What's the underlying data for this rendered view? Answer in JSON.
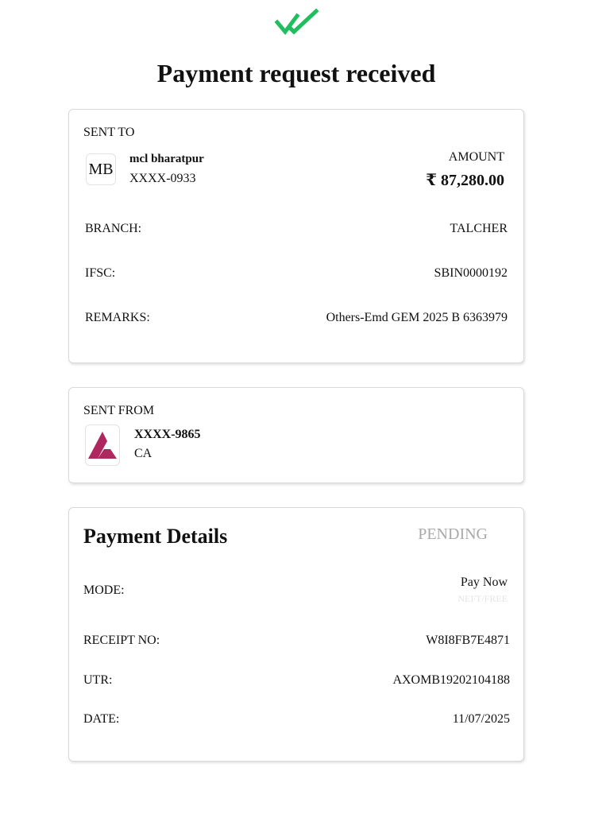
{
  "header": {
    "icon": "double-check-icon",
    "icon_color": "#1fbf5f",
    "title": "Payment request received"
  },
  "sent_to": {
    "section_label": "SENT TO",
    "avatar_initials": "MB",
    "payee_name": "mcl bharatpur",
    "account_masked": "XXXX-0933",
    "amount_label": "AMOUNT",
    "amount_value": "₹ 87,280.00",
    "rows": [
      {
        "label": "BRANCH:",
        "value": "TALCHER"
      },
      {
        "label": "IFSC:",
        "value": "SBIN0000192"
      },
      {
        "label": "REMARKS:",
        "value": "Others-Emd GEM 2025 B 6363979"
      }
    ]
  },
  "sent_from": {
    "section_label": "SENT FROM",
    "bank_logo_icon": "axis-bank-logo",
    "logo_color": "#ae275f",
    "account_masked": "XXXX-9865",
    "account_type": "CA"
  },
  "payment_details": {
    "title": "Payment Details",
    "status": "PENDING",
    "mode_label": "MODE:",
    "mode_value": "Pay Now",
    "mode_sub": "NEFT/FREE",
    "rows": [
      {
        "label": "RECEIPT NO:",
        "value": "W8I8FB7E4871"
      },
      {
        "label": "UTR:",
        "value": "AXOMB19202104188"
      },
      {
        "label": "DATE:",
        "value": "11/07/2025"
      }
    ]
  }
}
